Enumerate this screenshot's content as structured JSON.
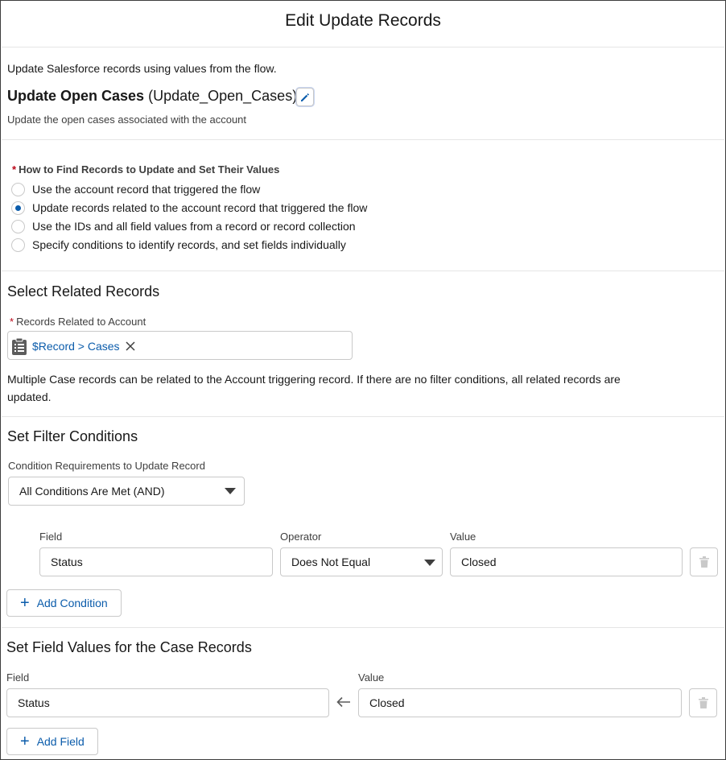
{
  "modal": {
    "title": "Edit Update Records"
  },
  "header": {
    "description": "Update Salesforce records using values from the flow.",
    "element_label": "Update Open Cases",
    "element_api_name": "(Update_Open_Cases)",
    "element_description": "Update the open cases associated with the account"
  },
  "find_records": {
    "required_marker": "*",
    "label": "How to Find Records to Update and Set Their Values",
    "options": [
      {
        "label": "Use the account record that triggered the flow",
        "selected": false
      },
      {
        "label": "Update records related to the account record that triggered the flow",
        "selected": true
      },
      {
        "label": "Use the IDs and all field values from a record or record collection",
        "selected": false
      },
      {
        "label": "Specify conditions to identify records, and set fields individually",
        "selected": false
      }
    ]
  },
  "related_records": {
    "heading": "Select Related Records",
    "required_marker": "*",
    "field_label": "Records Related to Account",
    "pill_value": "$Record > Cases",
    "help_text_line1": "Multiple Case records can be related to the Account triggering record. If there are no filter conditions, all related records are",
    "help_text_line2": "updated."
  },
  "filter_conditions": {
    "heading": "Set Filter Conditions",
    "requirements_label": "Condition Requirements to Update Record",
    "requirements_value": "All Conditions Are Met (AND)",
    "col_field": "Field",
    "col_operator": "Operator",
    "col_value": "Value",
    "row": {
      "field": "Status",
      "operator": "Does Not Equal",
      "value": "Closed"
    },
    "add_condition_label": "Add Condition"
  },
  "field_values": {
    "heading": "Set Field Values for the Case Records",
    "col_field": "Field",
    "col_value": "Value",
    "row": {
      "field": "Status",
      "value": "Closed"
    },
    "add_field_label": "Add Field"
  },
  "colors": {
    "brand": "#0b5cab",
    "required": "#ba0517",
    "border": "#c9c9c9"
  },
  "icons": [
    "edit-pencil-icon",
    "clipboard-record-icon",
    "close-icon",
    "chevron-down-icon",
    "trash-icon",
    "add-icon",
    "left-arrow-icon"
  ]
}
